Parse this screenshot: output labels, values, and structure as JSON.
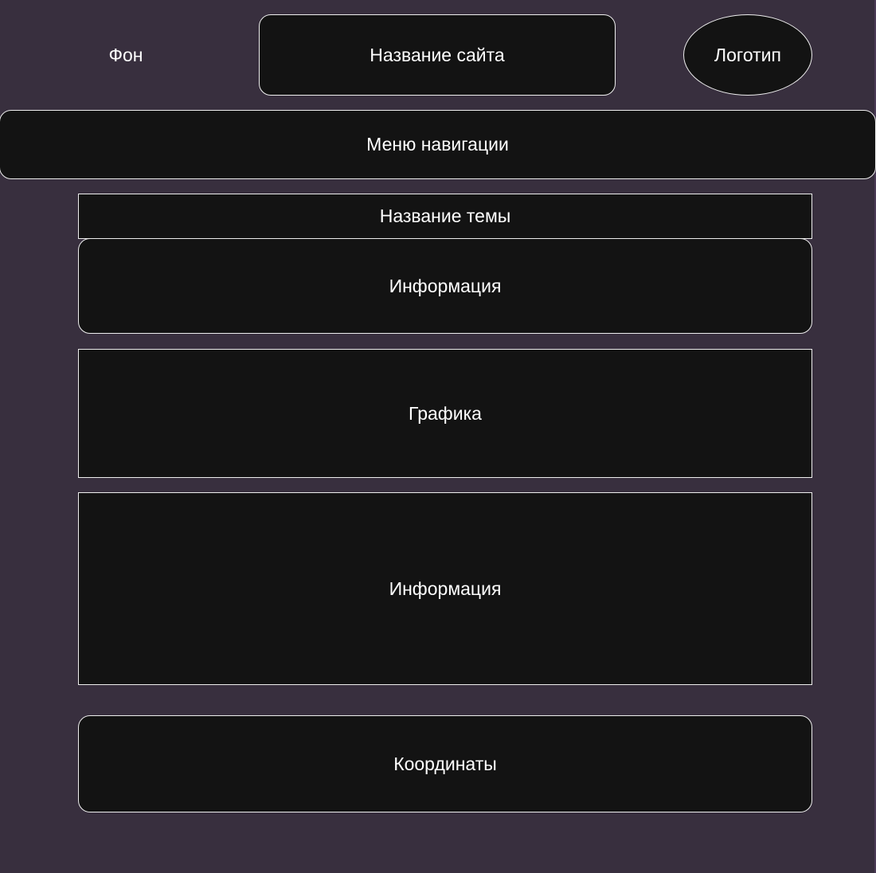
{
  "colors": {
    "background": "#382f3e",
    "box_fill": "#131313",
    "box_stroke": "#eeeeee",
    "text": "#ffffff"
  },
  "header": {
    "background_label": "Фон",
    "site_title_label": "Название сайта",
    "logo_label": "Логотип"
  },
  "navigation": {
    "label": "Меню навигации"
  },
  "content": {
    "topic_title_label": "Название темы",
    "info_label_top": "Информация",
    "graphics_label": "Графика",
    "info_label_bottom": "Информация",
    "coordinates_label": "Координаты"
  }
}
